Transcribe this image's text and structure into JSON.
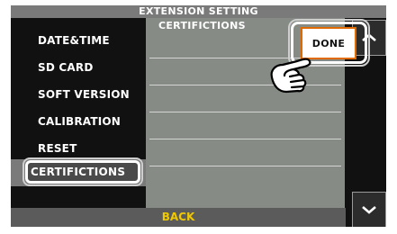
{
  "title": "EXTENSION SETTING",
  "menu": [
    {
      "label": "DATE&TIME"
    },
    {
      "label": "SD CARD"
    },
    {
      "label": "SOFT VERSION"
    },
    {
      "label": "CALIBRATION"
    },
    {
      "label": "RESET"
    },
    {
      "label": "CERTIFICTIONS",
      "selected": true
    }
  ],
  "panel": {
    "header": "CERTIFICTIONS"
  },
  "done_label": "DONE",
  "footer": {
    "back_label": "BACK"
  },
  "icons": {
    "scroll_up": "chevron-up-icon",
    "scroll_down": "chevron-down-icon",
    "pointer": "pointing-hand-icon"
  },
  "colors": {
    "accent": "#f0c800",
    "done_border": "#e06a00",
    "panel": "#868b86",
    "screen": "#111111"
  }
}
